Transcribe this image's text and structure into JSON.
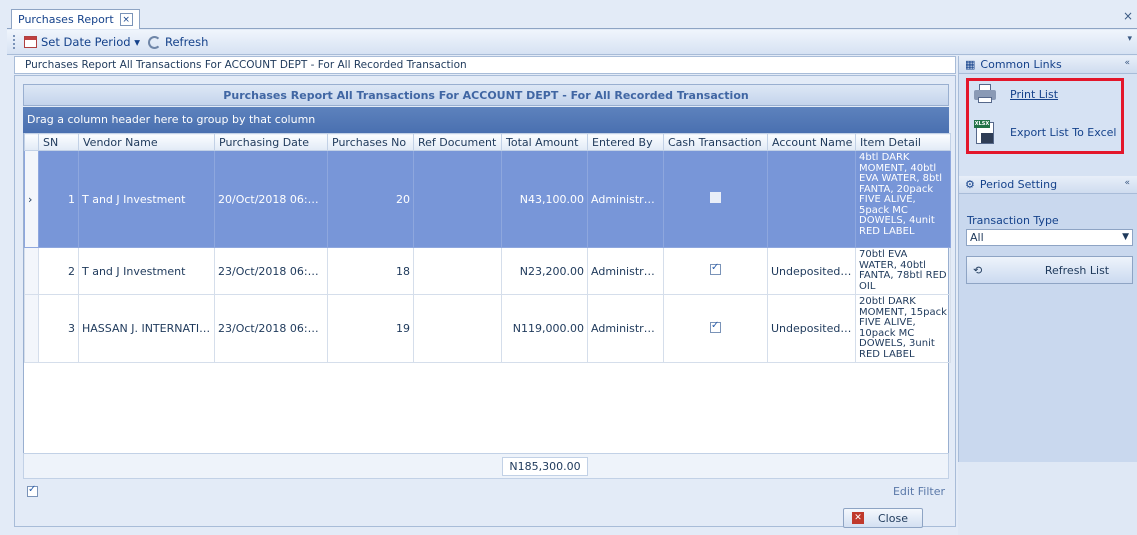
{
  "tab": {
    "title": "Purchases Report",
    "close": "×"
  },
  "window": {
    "close": "×"
  },
  "toolbar": {
    "set_date_period": "Set Date Period ▾",
    "refresh": "Refresh",
    "more": "▾"
  },
  "report": {
    "header": "Purchases Report All Transactions For ACCOUNT DEPT - For All Recorded Transaction",
    "grid_title": "Purchases Report All Transactions For ACCOUNT DEPT - For All Recorded Transaction",
    "group_hint": "Drag a column header here to group by that column"
  },
  "columns": [
    "SN",
    "Vendor Name",
    "Purchasing Date",
    "Purchases No",
    "Ref Document",
    "Total Amount",
    "Entered By",
    "Cash Transaction",
    "Account Name",
    "Item Detail"
  ],
  "rows": [
    {
      "sn": "1",
      "vendor": "T and J Investment",
      "date": "20/Oct/2018 06:35 ...",
      "no": "20",
      "ref": "",
      "amount": "N43,100.00",
      "entered_by": "Administrator",
      "cash": "unset",
      "account": "",
      "items": "4btl DARK MOMENT, 40btl EVA WATER, 8btl FANTA, 20pack FIVE ALIVE, 5pack MC DOWELS, 4unit RED LABEL",
      "selected": true
    },
    {
      "sn": "2",
      "vendor": "T and J Investment",
      "date": "23/Oct/2018 06:16 ...",
      "no": "18",
      "ref": "",
      "amount": "N23,200.00",
      "entered_by": "Administrator",
      "cash": "checked",
      "account": "Undeposited C...",
      "items": "70btl EVA WATER, 40btl FANTA, 78btl RED OIL",
      "selected": false
    },
    {
      "sn": "3",
      "vendor": "HASSAN J. INTERNATIO...",
      "date": "23/Oct/2018 06:17 ...",
      "no": "19",
      "ref": "",
      "amount": "N119,000.00",
      "entered_by": "Administrator",
      "cash": "checked",
      "account": "Undeposited C...",
      "items": "20btl DARK MOMENT, 15pack FIVE ALIVE, 10pack MC DOWELS, 3unit RED LABEL",
      "selected": false
    }
  ],
  "total": "N185,300.00",
  "edit_filter": "Edit Filter",
  "close_button": "Close",
  "side": {
    "common_links": "Common Links",
    "print_list": "Print List",
    "export_excel": "Export List To Excel",
    "xls_tag": "XLSX",
    "period_setting": "Period Setting",
    "transaction_type_label": "Transaction Type",
    "transaction_type_value": "All",
    "refresh_list": "Refresh List",
    "collapse": "«"
  },
  "colors": {
    "selected_row": "#7896d8",
    "group_bar": "#4a70b0",
    "highlight_box": "#e3162a"
  }
}
